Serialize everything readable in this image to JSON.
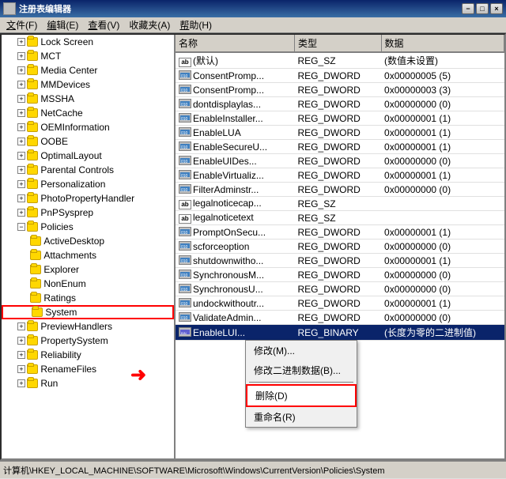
{
  "title_bar": {
    "title": "注册表编辑器",
    "min_label": "−",
    "max_label": "□",
    "close_label": "×"
  },
  "menu": {
    "items": [
      {
        "label": "文件(F)",
        "key": "F"
      },
      {
        "label": "编辑(E)",
        "key": "E"
      },
      {
        "label": "查看(V)",
        "key": "V"
      },
      {
        "label": "收藏夹(A)",
        "key": "A"
      },
      {
        "label": "帮助(H)",
        "key": "H"
      }
    ]
  },
  "tree": {
    "items": [
      {
        "label": "Lock Screen",
        "indent": 1,
        "expanded": false
      },
      {
        "label": "MCT",
        "indent": 1,
        "expanded": false
      },
      {
        "label": "Media Center",
        "indent": 1,
        "expanded": false
      },
      {
        "label": "MMDevices",
        "indent": 1,
        "expanded": false
      },
      {
        "label": "MSSHA",
        "indent": 1,
        "expanded": false
      },
      {
        "label": "NetCache",
        "indent": 1,
        "expanded": false
      },
      {
        "label": "OEMInformation",
        "indent": 1,
        "expanded": false
      },
      {
        "label": "OOBE",
        "indent": 1,
        "expanded": false
      },
      {
        "label": "OptimalLayout",
        "indent": 1,
        "expanded": false
      },
      {
        "label": "Parental Controls",
        "indent": 1,
        "expanded": false
      },
      {
        "label": "Personalization",
        "indent": 1,
        "expanded": false
      },
      {
        "label": "PhotoPropertyHandler",
        "indent": 1,
        "expanded": false
      },
      {
        "label": "PnPSysprep",
        "indent": 1,
        "expanded": false
      },
      {
        "label": "Policies",
        "indent": 1,
        "expanded": true
      },
      {
        "label": "ActiveDesktop",
        "indent": 2
      },
      {
        "label": "Attachments",
        "indent": 2
      },
      {
        "label": "Explorer",
        "indent": 2
      },
      {
        "label": "NonEnum",
        "indent": 2
      },
      {
        "label": "Ratings",
        "indent": 2
      },
      {
        "label": "System",
        "indent": 2,
        "selected": true
      },
      {
        "label": "PreviewHandlers",
        "indent": 1,
        "expanded": false
      },
      {
        "label": "PropertySystem",
        "indent": 1,
        "expanded": false
      },
      {
        "label": "Reliability",
        "indent": 1,
        "expanded": false
      },
      {
        "label": "RenameFiles",
        "indent": 1,
        "expanded": false
      },
      {
        "label": "Run",
        "indent": 1,
        "expanded": false
      }
    ]
  },
  "columns": {
    "name": "名称",
    "type": "类型",
    "data": "数据"
  },
  "registry_values": [
    {
      "icon": "ab",
      "name": "(默认)",
      "type": "REG_SZ",
      "data": "(数值未设置)"
    },
    {
      "icon": "dword",
      "name": "ConsentPromp...",
      "type": "REG_DWORD",
      "data": "0x00000005 (5)"
    },
    {
      "icon": "dword",
      "name": "ConsentPromp...",
      "type": "REG_DWORD",
      "data": "0x00000003 (3)"
    },
    {
      "icon": "dword",
      "name": "dontdisplaylas...",
      "type": "REG_DWORD",
      "data": "0x00000000 (0)"
    },
    {
      "icon": "dword",
      "name": "EnableInstaller...",
      "type": "REG_DWORD",
      "data": "0x00000001 (1)"
    },
    {
      "icon": "dword",
      "name": "EnableLUA",
      "type": "REG_DWORD",
      "data": "0x00000001 (1)"
    },
    {
      "icon": "dword",
      "name": "EnableSecureU...",
      "type": "REG_DWORD",
      "data": "0x00000001 (1)"
    },
    {
      "icon": "dword",
      "name": "EnableUIDes...",
      "type": "REG_DWORD",
      "data": "0x00000000 (0)"
    },
    {
      "icon": "dword",
      "name": "EnableVirtualiz...",
      "type": "REG_DWORD",
      "data": "0x00000001 (1)"
    },
    {
      "icon": "dword",
      "name": "FilterAdminstr...",
      "type": "REG_DWORD",
      "data": "0x00000000 (0)"
    },
    {
      "icon": "ab",
      "name": "legalnoticecap...",
      "type": "REG_SZ",
      "data": ""
    },
    {
      "icon": "ab",
      "name": "legalnoticetext",
      "type": "REG_SZ",
      "data": ""
    },
    {
      "icon": "dword",
      "name": "PromptOnSecu...",
      "type": "REG_DWORD",
      "data": "0x00000001 (1)"
    },
    {
      "icon": "dword",
      "name": "scforceoption",
      "type": "REG_DWORD",
      "data": "0x00000000 (0)"
    },
    {
      "icon": "dword",
      "name": "shutdownwitho...",
      "type": "REG_DWORD",
      "data": "0x00000001 (1)"
    },
    {
      "icon": "dword",
      "name": "SynchronousM...",
      "type": "REG_DWORD",
      "data": "0x00000000 (0)"
    },
    {
      "icon": "dword",
      "name": "SynchronousU...",
      "type": "REG_DWORD",
      "data": "0x00000000 (0)"
    },
    {
      "icon": "dword",
      "name": "undockwithoutr...",
      "type": "REG_DWORD",
      "data": "0x00000001 (1)"
    },
    {
      "icon": "dword",
      "name": "ValidateAdmin...",
      "type": "REG_DWORD",
      "data": "0x00000000 (0)"
    },
    {
      "icon": "binary",
      "name": "EnableLUI...",
      "type": "REG_BINARY",
      "data": "(长度为零的二进制值)",
      "selected": true
    }
  ],
  "context_menu": {
    "items": [
      {
        "label": "修改(M)...",
        "key": "M"
      },
      {
        "label": "修改二进制数据(B)...",
        "key": "B"
      },
      {
        "separator": true
      },
      {
        "label": "删除(D)",
        "key": "D",
        "highlighted": true
      },
      {
        "label": "重命名(R)",
        "key": "R"
      }
    ]
  },
  "status_bar": {
    "text": "计算机\\HKEY_LOCAL_MACHINE\\SOFTWARE\\Microsoft\\Windows\\CurrentVersion\\Policies\\System"
  }
}
